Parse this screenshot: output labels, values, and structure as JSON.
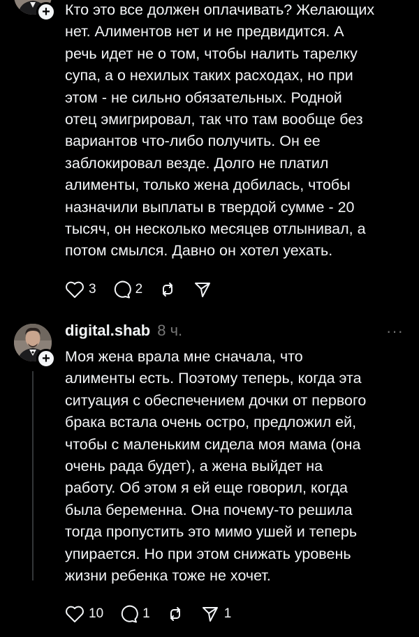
{
  "posts": [
    {
      "text": "Кто это все должен оплачивать? Желающих\nнет. Алиментов нет и не предвидится. А\nречь идет не о том, чтобы налить тарелку\nсупа, а о нехилых таких расходах, но при\nэтом - не сильно обязательных. Родной\nотец эмигрировал, так что там вообще без\nвариантов что-либо получить. Он ее\nзаблокировал везде. Долго не платил\nалименты, только жена добилась, чтобы\nназначили выплаты в твердой сумме - 20\nтысяч, он несколько месяцев отлынивал, а\nпотом смылся. Давно он хотел уехать.",
      "likes": "3",
      "comments": "2",
      "reposts": "",
      "shares": ""
    },
    {
      "username": "digital.shab",
      "time": "8 ч.",
      "text": "Моя жена врала мне сначала, что\nалименты есть. Поэтому теперь, когда эта\nситуация с обеспечением дочки от первого\nбрака встала очень остро, предложил ей,\nчтобы с маленьким сидела моя мама (она\nочень рада будет), а жена выйдет на\nработу. Об этом я ей еще говорил, когда\nбыла беременна. Она почему-то решила\nтогда пропустить это мимо ушей и теперь\nупирается. Но при этом снижать уровень\nжизни ребенка тоже не хочет.",
      "likes": "10",
      "comments": "1",
      "reposts": "",
      "shares": "1"
    }
  ],
  "icons": {
    "like": "heart-icon",
    "comment": "comment-bubble-icon",
    "repost": "repost-arrows-icon",
    "share": "send-paper-plane-icon",
    "follow": "plus-icon",
    "menu": "more-dots-icon"
  },
  "colors": {
    "background": "#000000",
    "text": "#f3f5f7",
    "secondary": "#777777",
    "follow_badge": "#f3f5f7"
  }
}
